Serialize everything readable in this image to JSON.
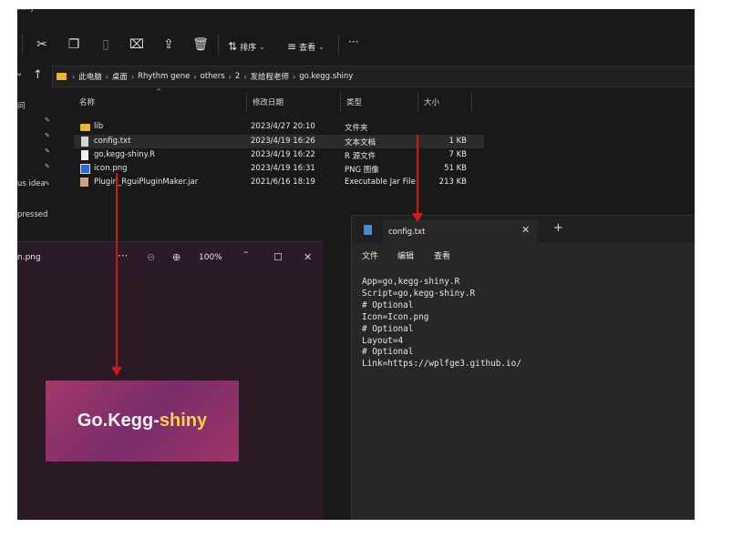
{
  "window": {
    "title": "hiny"
  },
  "toolbar": {
    "sort_label": "排序",
    "view_label": "查看",
    "more_label": "···"
  },
  "nav": {
    "breadcrumb": [
      "此电脑",
      "桌面",
      "Rhythm gene",
      "others",
      "2",
      "发给程老师",
      "go.kegg.shiny"
    ]
  },
  "sidebar": {
    "items": [
      {
        "label": "问"
      },
      {
        "label": "us idea"
      },
      {
        "label": "pressed"
      }
    ]
  },
  "files": {
    "columns": [
      "名称",
      "修改日期",
      "类型",
      "大小"
    ],
    "rows": [
      {
        "name": "lib",
        "date": "2023/4/27 20:10",
        "type": "文件夹",
        "size": "",
        "icon": "folder-icon"
      },
      {
        "name": "config.txt",
        "date": "2023/4/19 16:26",
        "type": "文本文档",
        "size": "1 KB",
        "icon": "text-file-icon"
      },
      {
        "name": "go,kegg-shiny.R",
        "date": "2023/4/19 16:22",
        "type": "R 源文件",
        "size": "7 KB",
        "icon": "r-file-icon"
      },
      {
        "name": "icon.png",
        "date": "2023/4/19 16:31",
        "type": "PNG 图像",
        "size": "51 KB",
        "icon": "image-file-icon"
      },
      {
        "name": "Plugin_RguiPluginMaker.jar",
        "date": "2021/6/16 18:19",
        "type": "Executable Jar File",
        "size": "213 KB",
        "icon": "jar-file-icon"
      }
    ]
  },
  "viewer": {
    "title": "n.png",
    "more": "···",
    "zoom": "100%",
    "image_text_a": "Go.Kegg-",
    "image_text_b": "shiny"
  },
  "notepad": {
    "tab_title": "config.txt",
    "menu": [
      "文件",
      "编辑",
      "查看"
    ],
    "content": "App=go,kegg-shiny.R\nScript=go,kegg-shiny.R\n# Optional\nIcon=Icon.png\n# Optional\nLayout=4\n# Optional\nLink=https://wplfge3.github.io/"
  },
  "colors": {
    "arrow": "#d01818",
    "folder": "#e8b63a",
    "accent": "#3f8de0"
  }
}
